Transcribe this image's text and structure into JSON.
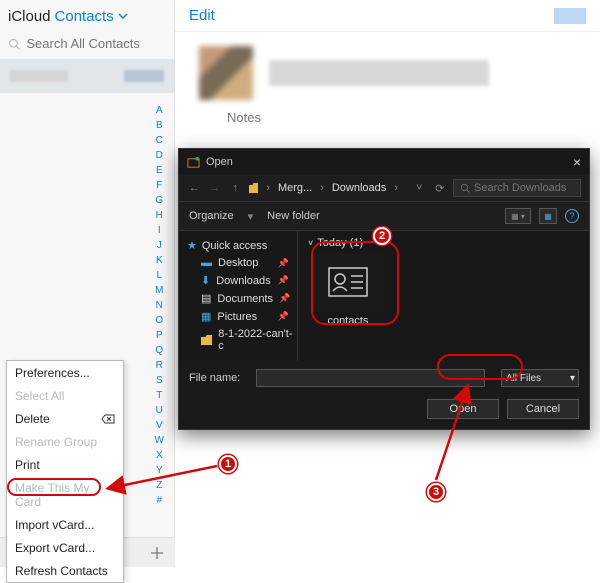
{
  "brand": {
    "icloud": "iCloud",
    "contacts": "Contacts"
  },
  "search": {
    "placeholder": "Search All Contacts"
  },
  "index_letters": [
    "A",
    "B",
    "C",
    "D",
    "E",
    "F",
    "G",
    "H",
    "I",
    "J",
    "K",
    "L",
    "M",
    "N",
    "O",
    "P",
    "Q",
    "R",
    "S",
    "T",
    "U",
    "V",
    "W",
    "X",
    "Y",
    "Z",
    "#"
  ],
  "main": {
    "edit": "Edit",
    "notes": "Notes"
  },
  "ctx": {
    "preferences": "Preferences...",
    "select_all": "Select All",
    "delete": "Delete",
    "rename": "Rename Group",
    "print": "Print",
    "make_card": "Make This My Card",
    "import": "Import vCard...",
    "export": "Export vCard...",
    "refresh": "Refresh Contacts"
  },
  "dialog": {
    "title": "Open",
    "crumb1": "Merg...",
    "crumb2": "Downloads",
    "search_placeholder": "Search Downloads",
    "organize": "Organize",
    "new_folder": "New folder",
    "nav": {
      "quick": "Quick access",
      "desktop": "Desktop",
      "downloads": "Downloads",
      "documents": "Documents",
      "pictures": "Pictures",
      "folder_8": "8-1-2022-can't-c"
    },
    "group_today": "Today (1)",
    "file_contacts": "contacts",
    "file_name_label": "File name:",
    "filter": "All Files",
    "open": "Open",
    "cancel": "Cancel"
  },
  "badges": {
    "b1": "1",
    "b2": "2",
    "b3": "3"
  }
}
